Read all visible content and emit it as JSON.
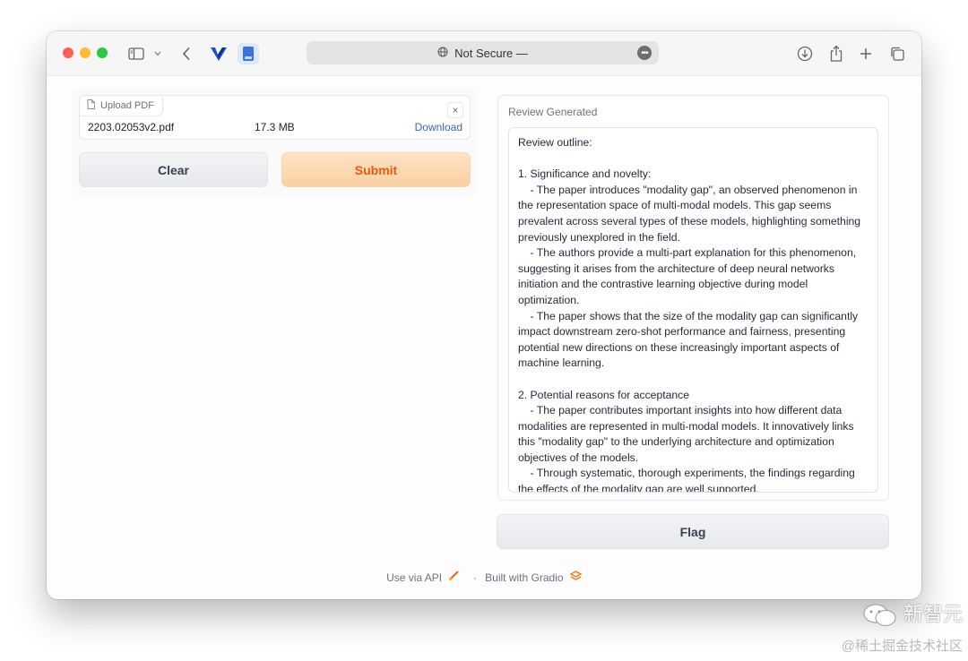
{
  "browser": {
    "url_text": "Not Secure —"
  },
  "upload": {
    "tab_label": "Upload PDF",
    "file_name": "2203.02053v2.pdf",
    "file_size": "17.3 MB",
    "download_label": "Download",
    "close_symbol": "×"
  },
  "actions": {
    "clear_label": "Clear",
    "submit_label": "Submit",
    "flag_label": "Flag"
  },
  "review": {
    "label": "Review Generated",
    "text": "Review outline:\n\n1. Significance and novelty:\n    - The paper introduces \"modality gap\", an observed phenomenon in the representation space of multi-modal models. This gap seems prevalent across several types of these models, highlighting something previously unexplored in the field.\n    - The authors provide a multi-part explanation for this phenomenon, suggesting it arises from the architecture of deep neural networks initiation and the contrastive learning objective during model optimization.\n    - The paper shows that the size of the modality gap can significantly impact downstream zero-shot performance and fairness, presenting potential new directions on these increasingly important aspects of machine learning.\n\n2. Potential reasons for acceptance\n    - The paper contributes important insights into how different data modalities are represented in multi-modal models. It innovatively links this \"modality gap\" to the underlying architecture and optimization objectives of the models.\n    - Through systematic, thorough experiments, the findings regarding the effects of the modality gap are well supported."
  },
  "footer": {
    "api_label": "Use via API",
    "separator": "·",
    "built_label": "Built with Gradio"
  },
  "watermark": {
    "line1": "新智元",
    "line2": "@稀土掘金技术社区"
  },
  "icons": [
    "sidebar-icon",
    "chevron-down-icon",
    "back-icon",
    "vivaldi-logo-icon",
    "document-tab-icon",
    "globe-icon",
    "more-icon",
    "download-icon",
    "share-icon",
    "plus-icon",
    "tabs-icon",
    "file-icon",
    "rocket-icon",
    "gradio-logo-icon",
    "wechat-icon"
  ],
  "colors": {
    "accent_orange": "#ea580c",
    "link_blue": "#3b63c4",
    "traffic_red": "#fe5f57",
    "traffic_yellow": "#febc2e",
    "traffic_green": "#28c840"
  }
}
